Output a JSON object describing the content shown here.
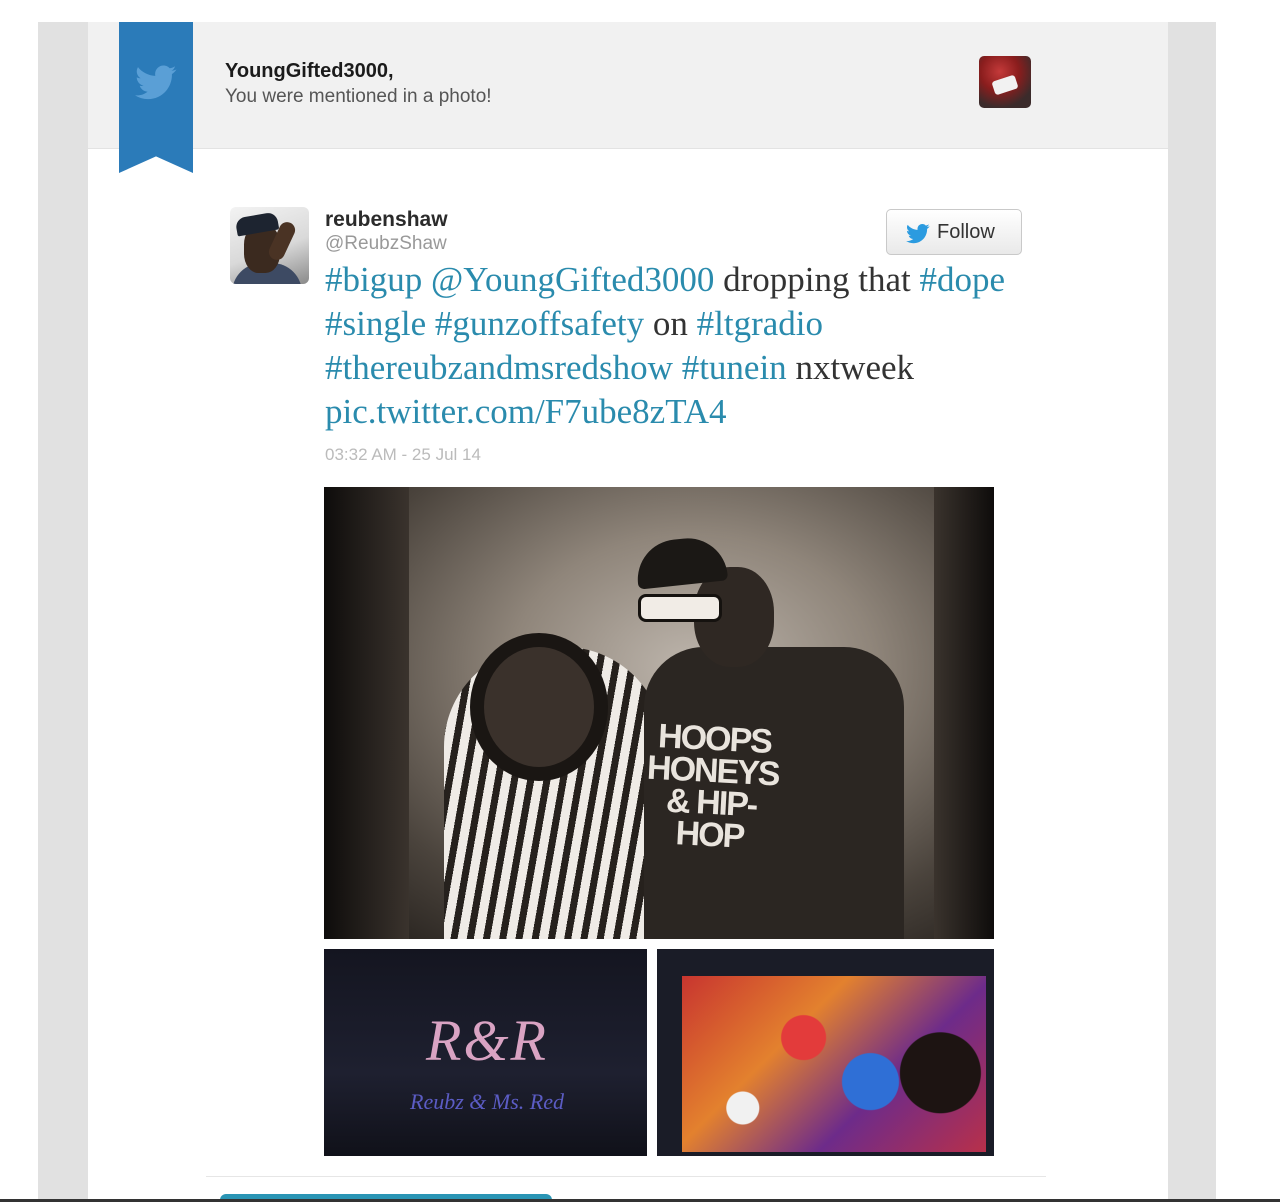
{
  "notification": {
    "recipient": "YoungGifted3000,",
    "message": "You were mentioned in a photo!"
  },
  "tweet": {
    "author_name": "reubenshaw",
    "author_handle": "@ReubzShaw",
    "follow_label": "Follow",
    "text": {
      "t1": "#bigup",
      "t2": "@YoungGifted3000",
      "t3": "dropping that",
      "t4": "#dope",
      "t5": "#single",
      "t6": "#gunzoffsafety",
      "t7": "on",
      "t8": "#ltgradio",
      "t9": "#thereubzandmsredshow",
      "t10": "#tunein",
      "t11": "nxtweek",
      "t12": "pic.twitter.com/F7ube8zTA4"
    },
    "timestamp": "03:32 AM - 25 Jul 14"
  },
  "photo": {
    "shirt_text": "HOOPS HONEYS & HIP-HOP",
    "logo_text": "R&R",
    "logo_subtext": "Reubz & Ms. Red"
  },
  "colors": {
    "brand_blue": "#2b7bb9",
    "link_teal": "#2a8bad"
  },
  "icons": {
    "ribbon": "twitter-bird-icon",
    "follow": "twitter-bird-icon"
  }
}
